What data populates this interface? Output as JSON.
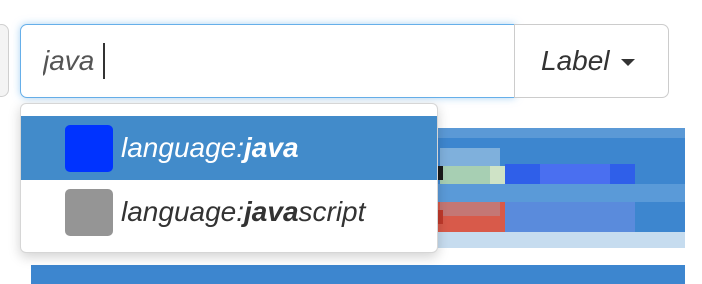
{
  "search": {
    "value": "java"
  },
  "label_button": {
    "label": "Label"
  },
  "suggestions": [
    {
      "prefix": "language:",
      "match": "java",
      "rest": "",
      "color": "#0033ff",
      "active": true
    },
    {
      "prefix": "language:",
      "match": "java",
      "rest": "script",
      "color": "#959595",
      "active": false
    }
  ],
  "colors": {
    "accent": "#428bca",
    "focus_border": "#66afe9",
    "java": "#0033ff",
    "javascript": "#959595"
  }
}
